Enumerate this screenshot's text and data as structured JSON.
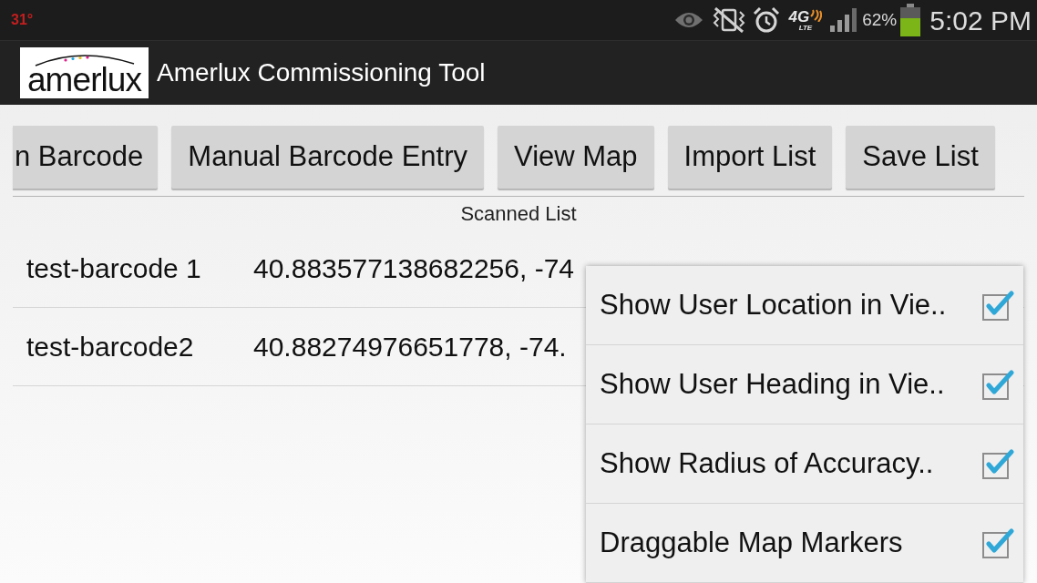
{
  "status_bar": {
    "temperature": "31°",
    "network": {
      "type": "4G",
      "subtype": "LTE"
    },
    "battery_percent": "62%",
    "time": "5:02 PM"
  },
  "app_bar": {
    "logo_text": "amerlux",
    "title": "Amerlux Commissioning Tool"
  },
  "toolbar": {
    "buttons": [
      "n Barcode",
      "Manual Barcode Entry",
      "View Map",
      "Import List",
      "Save List"
    ]
  },
  "scanned_list": {
    "title": "Scanned List",
    "rows": [
      {
        "name": "test-barcode 1",
        "coordinates": "40.883577138682256, -74"
      },
      {
        "name": "test-barcode2",
        "coordinates": "40.88274976651778, -74."
      }
    ]
  },
  "menu": {
    "items": [
      {
        "label": "Show User Location in Vie..",
        "checked": true
      },
      {
        "label": "Show User Heading in Vie..",
        "checked": true
      },
      {
        "label": "Show Radius of Accuracy..",
        "checked": true
      },
      {
        "label": "Draggable Map Markers",
        "checked": true
      }
    ]
  }
}
